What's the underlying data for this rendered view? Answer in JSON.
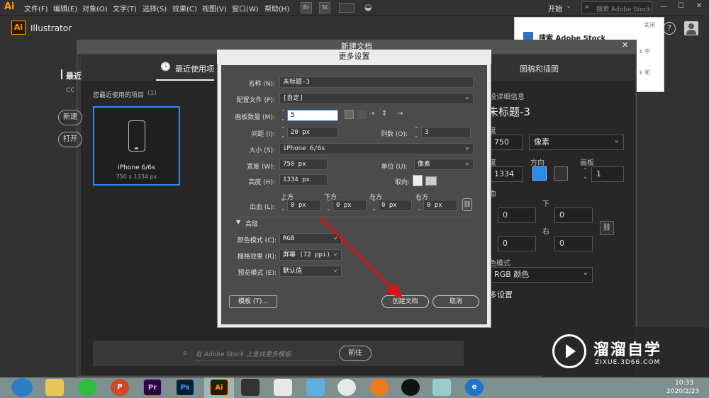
{
  "menubar": {
    "logo": "Ai",
    "items": [
      "文件(F)",
      "编辑(E)",
      "对象(O)",
      "文字(T)",
      "选择(S)",
      "效果(C)",
      "视图(V)",
      "窗口(W)",
      "帮助(H)"
    ],
    "br": "Br",
    "st": "St",
    "workspace": "开始",
    "search_placeholder": "搜索 Adobe Stock"
  },
  "app": {
    "logo": "Ai",
    "name": "Illustrator"
  },
  "stock_popup": {
    "title": "搜索 Adobe Stock",
    "close": "关闭",
    "frag1": "k 中",
    "frag2": "k 和"
  },
  "new_doc": {
    "title": "新建文档",
    "tab_recent": "最近使用项",
    "tab_art": "图稿和插图",
    "left_heading": "最近",
    "left_sub": "CC",
    "btn_new": "新建",
    "btn_open": "打开",
    "recent_label": "您最近使用的项目",
    "recent_count": "(1)",
    "preset_name": "iPhone 6/6s",
    "preset_size": "750 x 1334 px",
    "stock_search": "在 Adobe Stock 上查找更多模板",
    "go_button": "前往"
  },
  "right_panel": {
    "heading": "设详细信息",
    "doc_name": "未标题-3",
    "width_label": "度",
    "width_value": "750",
    "unit": "像素",
    "height_label": "度",
    "orient_label": "方向",
    "artboards_label": "画板",
    "height_value": "1334",
    "artboards_value": "1",
    "bleed_label": "血",
    "down_label": "下",
    "right_label": "右",
    "bleed_vals": [
      "0",
      "0",
      "0",
      "0"
    ],
    "color_mode_label": "色模式",
    "color_mode": "RGB 颜色",
    "more_settings": "多设置"
  },
  "more_settings": {
    "title": "更多设置",
    "name_label": "名称 (N):",
    "name_value": "未标题-3",
    "profile_label": "配置文件 (P):",
    "profile_value": "[自定]",
    "artboards_label": "画板数量 (M):",
    "artboards_value": "5",
    "spacing_label": "间距 (I):",
    "spacing_value": "20 px",
    "columns_label": "列数 (O):",
    "columns_value": "3",
    "size_label": "大小 (S):",
    "size_value": "iPhone 6/6s",
    "width_label": "宽度 (W):",
    "width_value": "750 px",
    "units_label": "单位 (U):",
    "units_value": "像素",
    "height_label": "高度 (H):",
    "height_value": "1334 px",
    "orient_label": "取向:",
    "bleed_label": "出血 (L):",
    "bleed_top_label": "上方",
    "bleed_bottom_label": "下方",
    "bleed_left_label": "左方",
    "bleed_right_label": "右方",
    "bleed_top": "0 px",
    "bleed_bottom": "0 px",
    "bleed_left": "0 px",
    "bleed_right": "0 px",
    "advanced": "高级",
    "color_mode_label": "颜色模式 (C):",
    "color_mode": "RGB",
    "raster_label": "栅格效果 (R):",
    "raster_value": "屏幕 (72 ppi)",
    "preview_label": "预览模式 (E):",
    "preview_value": "默认值",
    "template_button": "模板 (T)...",
    "create_button": "创建文档",
    "cancel_button": "取消"
  },
  "watermark": {
    "title": "溜溜自学",
    "url": "ZIXUE.3D66.COM"
  },
  "clock": {
    "time": "10:33",
    "date": "2020/2/23"
  },
  "taskbar_icons": [
    "Pr",
    "Ps",
    "Ai"
  ],
  "colors": {
    "accent": "#2d8ceb",
    "ai_orange": "#ff9a00",
    "arrow": "#e01010"
  }
}
